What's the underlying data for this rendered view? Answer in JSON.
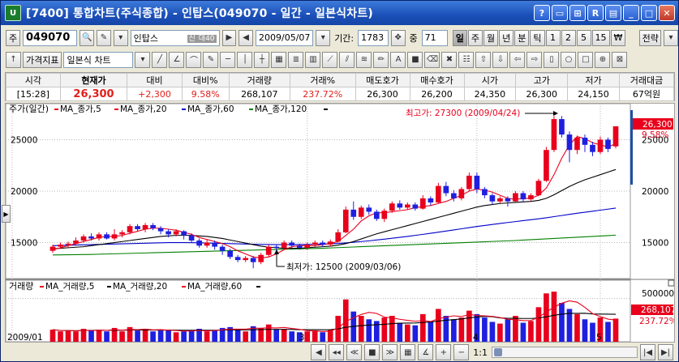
{
  "window": {
    "logo": "U",
    "title": "[7400] 통합차트(주식종합) - 인탑스(049070 - 일간 - 일본식차트)",
    "buttons": [
      "?",
      "▭",
      "⊞",
      "R",
      "▤",
      "_",
      "□",
      "✕"
    ]
  },
  "toolbar1": {
    "market_label": "주",
    "code": "049070",
    "stock_name": "인탑스",
    "badge_credit": "신",
    "badge_margin": "대40",
    "date": "2009/05/07",
    "period_label": "기간:",
    "period_value": "1783",
    "count_label": "중",
    "count_value": "71",
    "intervals": [
      "일",
      "주",
      "월",
      "년",
      "분",
      "틱",
      "1",
      "2",
      "5",
      "15",
      "₩"
    ],
    "selected_interval": "일",
    "strategy_label": "전략"
  },
  "toolbar2": {
    "price_indicator_label": "가격지표",
    "chart_style": "일본식 차트"
  },
  "quote": {
    "headers": [
      "시각",
      "현재가",
      "대비",
      "대비%",
      "거래량",
      "거래%",
      "매도호가",
      "매수호가",
      "시가",
      "고가",
      "저가",
      "거래대금"
    ],
    "values": [
      "[15:28]",
      "26,300",
      "+2,300",
      "9.58%",
      "268,107",
      "237.72%",
      "26,300",
      "26,200",
      "24,350",
      "26,300",
      "24,150",
      "67억원"
    ]
  },
  "price_chart": {
    "legend_title": "주가(일간)",
    "legend": [
      {
        "name": "MA_종가,5",
        "color": "#e8001c"
      },
      {
        "name": "MA_종가,20",
        "color": "#e8001c"
      },
      {
        "name": "MA_종가,60",
        "color": "#0000c8"
      },
      {
        "name": "MA_종가,120",
        "color": "#008000"
      }
    ],
    "high_annotation": "최고가: 27300 (2009/04/24)",
    "low_annotation": "최저가: 12500 (2009/03/06)",
    "current_price_label": "26,300",
    "current_change_label": "9.58%",
    "y_ticks": [
      "25000",
      "20000",
      "15000"
    ]
  },
  "volume_chart": {
    "legend_title": "거래량",
    "legend": [
      {
        "name": "MA_거래량,5",
        "color": "#e8001c"
      },
      {
        "name": "MA_거래량,20",
        "color": "#000000"
      },
      {
        "name": "MA_거래량,60",
        "color": "#e8001c"
      }
    ],
    "y_tick": "500000",
    "current_volume_label": "268,107",
    "current_ratio_label": "237.72%"
  },
  "x_axis": {
    "labels": [
      "2009/01",
      "3",
      "4",
      "5"
    ]
  },
  "chart_data": {
    "type": "candlestick",
    "y_range": [
      11500,
      28500
    ],
    "volume_range": [
      0,
      600000
    ],
    "candles": [
      {
        "o": 14200,
        "c": 14600,
        "h": 14800,
        "l": 14000,
        "v": 140000
      },
      {
        "o": 14600,
        "c": 14800,
        "h": 15000,
        "l": 14400,
        "v": 120000
      },
      {
        "o": 14800,
        "c": 14900,
        "h": 15100,
        "l": 14500,
        "v": 130000
      },
      {
        "o": 14900,
        "c": 15200,
        "h": 15500,
        "l": 14700,
        "v": 120000
      },
      {
        "o": 15200,
        "c": 15600,
        "h": 15800,
        "l": 15000,
        "v": 150000
      },
      {
        "o": 15600,
        "c": 15400,
        "h": 15900,
        "l": 15200,
        "v": 130000
      },
      {
        "o": 15400,
        "c": 15800,
        "h": 16000,
        "l": 15200,
        "v": 140000
      },
      {
        "o": 15800,
        "c": 15400,
        "h": 16000,
        "l": 15300,
        "v": 120000
      },
      {
        "o": 15400,
        "c": 15800,
        "h": 16300,
        "l": 15200,
        "v": 160000
      },
      {
        "o": 15800,
        "c": 16000,
        "h": 16200,
        "l": 15500,
        "v": 120000
      },
      {
        "o": 16000,
        "c": 16600,
        "h": 16800,
        "l": 15800,
        "v": 170000
      },
      {
        "o": 16600,
        "c": 16300,
        "h": 16800,
        "l": 16100,
        "v": 130000
      },
      {
        "o": 16300,
        "c": 16700,
        "h": 16900,
        "l": 16000,
        "v": 150000
      },
      {
        "o": 16700,
        "c": 16400,
        "h": 16900,
        "l": 16200,
        "v": 120000
      },
      {
        "o": 16400,
        "c": 16100,
        "h": 16600,
        "l": 15800,
        "v": 130000
      },
      {
        "o": 16100,
        "c": 15800,
        "h": 16300,
        "l": 15500,
        "v": 140000
      },
      {
        "o": 15800,
        "c": 16100,
        "h": 16300,
        "l": 15600,
        "v": 110000
      },
      {
        "o": 16100,
        "c": 15700,
        "h": 16200,
        "l": 15300,
        "v": 120000
      },
      {
        "o": 15700,
        "c": 15200,
        "h": 15900,
        "l": 15000,
        "v": 130000
      },
      {
        "o": 15200,
        "c": 14700,
        "h": 15400,
        "l": 14500,
        "v": 150000
      },
      {
        "o": 14700,
        "c": 15000,
        "h": 15300,
        "l": 14500,
        "v": 120000
      },
      {
        "o": 15000,
        "c": 14600,
        "h": 15200,
        "l": 14300,
        "v": 130000
      },
      {
        "o": 14600,
        "c": 14200,
        "h": 14800,
        "l": 13800,
        "v": 160000
      },
      {
        "o": 14200,
        "c": 13600,
        "h": 14400,
        "l": 13400,
        "v": 170000
      },
      {
        "o": 13600,
        "c": 13300,
        "h": 13800,
        "l": 13100,
        "v": 150000
      },
      {
        "o": 13300,
        "c": 13500,
        "h": 13700,
        "l": 13100,
        "v": 120000
      },
      {
        "o": 13500,
        "c": 13100,
        "h": 13700,
        "l": 12500,
        "v": 180000
      },
      {
        "o": 13100,
        "c": 13800,
        "h": 14000,
        "l": 12900,
        "v": 160000
      },
      {
        "o": 13800,
        "c": 14600,
        "h": 14800,
        "l": 13600,
        "v": 200000
      },
      {
        "o": 14600,
        "c": 14500,
        "h": 14800,
        "l": 14200,
        "v": 140000
      },
      {
        "o": 14500,
        "c": 15000,
        "h": 15200,
        "l": 14300,
        "v": 150000
      },
      {
        "o": 15000,
        "c": 14700,
        "h": 15200,
        "l": 14500,
        "v": 120000
      },
      {
        "o": 14700,
        "c": 14500,
        "h": 14900,
        "l": 14300,
        "v": 110000
      },
      {
        "o": 14500,
        "c": 14800,
        "h": 15000,
        "l": 14300,
        "v": 120000
      },
      {
        "o": 14800,
        "c": 15000,
        "h": 15200,
        "l": 14600,
        "v": 130000
      },
      {
        "o": 15000,
        "c": 14800,
        "h": 15200,
        "l": 14600,
        "v": 110000
      },
      {
        "o": 14800,
        "c": 15100,
        "h": 15300,
        "l": 14600,
        "v": 140000
      },
      {
        "o": 15100,
        "c": 16000,
        "h": 16300,
        "l": 15000,
        "v": 300000
      },
      {
        "o": 16000,
        "c": 18200,
        "h": 18500,
        "l": 15900,
        "v": 490000
      },
      {
        "o": 18200,
        "c": 17500,
        "h": 19000,
        "l": 17200,
        "v": 350000
      },
      {
        "o": 17500,
        "c": 18400,
        "h": 18600,
        "l": 17300,
        "v": 300000
      },
      {
        "o": 18400,
        "c": 18000,
        "h": 18700,
        "l": 17700,
        "v": 260000
      },
      {
        "o": 18000,
        "c": 17300,
        "h": 18200,
        "l": 17100,
        "v": 240000
      },
      {
        "o": 17300,
        "c": 18100,
        "h": 18300,
        "l": 17000,
        "v": 280000
      },
      {
        "o": 18100,
        "c": 18800,
        "h": 19000,
        "l": 17900,
        "v": 300000
      },
      {
        "o": 18800,
        "c": 18400,
        "h": 19100,
        "l": 18200,
        "v": 220000
      },
      {
        "o": 18400,
        "c": 18700,
        "h": 18900,
        "l": 18200,
        "v": 200000
      },
      {
        "o": 18700,
        "c": 18300,
        "h": 18900,
        "l": 18100,
        "v": 190000
      },
      {
        "o": 18300,
        "c": 19300,
        "h": 19600,
        "l": 18200,
        "v": 320000
      },
      {
        "o": 19300,
        "c": 18900,
        "h": 19500,
        "l": 18600,
        "v": 240000
      },
      {
        "o": 18900,
        "c": 20500,
        "h": 20800,
        "l": 18800,
        "v": 380000
      },
      {
        "o": 20500,
        "c": 19800,
        "h": 20900,
        "l": 19500,
        "v": 300000
      },
      {
        "o": 19800,
        "c": 19300,
        "h": 20100,
        "l": 19000,
        "v": 260000
      },
      {
        "o": 19300,
        "c": 20200,
        "h": 20400,
        "l": 19100,
        "v": 280000
      },
      {
        "o": 20200,
        "c": 21500,
        "h": 21800,
        "l": 20000,
        "v": 360000
      },
      {
        "o": 21500,
        "c": 20200,
        "h": 21800,
        "l": 19800,
        "v": 320000
      },
      {
        "o": 20200,
        "c": 19600,
        "h": 20400,
        "l": 19300,
        "v": 280000
      },
      {
        "o": 19600,
        "c": 19000,
        "h": 19800,
        "l": 18700,
        "v": 230000
      },
      {
        "o": 19000,
        "c": 19300,
        "h": 19500,
        "l": 18800,
        "v": 210000
      },
      {
        "o": 19300,
        "c": 19000,
        "h": 19500,
        "l": 18500,
        "v": 260000
      },
      {
        "o": 19000,
        "c": 19800,
        "h": 20000,
        "l": 18900,
        "v": 300000
      },
      {
        "o": 19800,
        "c": 19200,
        "h": 20000,
        "l": 18900,
        "v": 220000
      },
      {
        "o": 19200,
        "c": 19600,
        "h": 19800,
        "l": 19000,
        "v": 240000
      },
      {
        "o": 19600,
        "c": 21000,
        "h": 21200,
        "l": 19500,
        "v": 400000
      },
      {
        "o": 21000,
        "c": 24000,
        "h": 24300,
        "l": 20900,
        "v": 560000
      },
      {
        "o": 24000,
        "c": 27000,
        "h": 27300,
        "l": 23800,
        "v": 580000
      },
      {
        "o": 27000,
        "c": 25500,
        "h": 27300,
        "l": 25200,
        "v": 450000
      },
      {
        "o": 25500,
        "c": 24000,
        "h": 25800,
        "l": 22800,
        "v": 380000
      },
      {
        "o": 24000,
        "c": 25200,
        "h": 25400,
        "l": 23600,
        "v": 320000
      },
      {
        "o": 25200,
        "c": 24500,
        "h": 25500,
        "l": 23800,
        "v": 260000
      },
      {
        "o": 24500,
        "c": 23800,
        "h": 24800,
        "l": 23400,
        "v": 220000
      },
      {
        "o": 23800,
        "c": 25000,
        "h": 25300,
        "l": 23600,
        "v": 280000
      },
      {
        "o": 25000,
        "c": 24100,
        "h": 25200,
        "l": 23800,
        "v": 230000
      },
      {
        "o": 24350,
        "c": 26300,
        "h": 26300,
        "l": 24150,
        "v": 268107
      }
    ],
    "ma5": [
      14300,
      14500,
      14700,
      14900,
      15100,
      15300,
      15500,
      15600,
      15600,
      15700,
      15900,
      16100,
      16300,
      16400,
      16400,
      16300,
      16200,
      16000,
      15800,
      15500,
      15300,
      15100,
      14900,
      14600,
      14200,
      13900,
      13600,
      13500,
      13600,
      13900,
      14300,
      14600,
      14700,
      14700,
      14700,
      14800,
      14900,
      15100,
      15700,
      16300,
      17100,
      17600,
      17900,
      17900,
      18000,
      18100,
      18200,
      18400,
      18500,
      18600,
      18800,
      19000,
      19300,
      19600,
      20000,
      20200,
      20100,
      19900,
      19600,
      19300,
      19200,
      19300,
      19300,
      19600,
      20300,
      21600,
      23200,
      24500,
      25300,
      25100,
      24700,
      24500,
      24300,
      24600
    ],
    "ma20": [
      14400,
      14450,
      14500,
      14550,
      14600,
      14700,
      14800,
      14900,
      15000,
      15100,
      15200,
      15300,
      15400,
      15500,
      15600,
      15650,
      15700,
      15700,
      15700,
      15650,
      15600,
      15500,
      15400,
      15250,
      15100,
      14950,
      14800,
      14650,
      14550,
      14500,
      14450,
      14450,
      14450,
      14500,
      14550,
      14600,
      14650,
      14750,
      14900,
      15100,
      15350,
      15600,
      15850,
      16050,
      16250,
      16450,
      16650,
      16850,
      17050,
      17250,
      17450,
      17650,
      17850,
      18050,
      18250,
      18450,
      18600,
      18700,
      18800,
      18850,
      18900,
      18950,
      19000,
      19100,
      19300,
      19650,
      20050,
      20450,
      20800,
      21100,
      21350,
      21600,
      21850,
      22100
    ],
    "ma60": [
      14700,
      14720,
      14740,
      14760,
      14780,
      14800,
      14820,
      14840,
      14860,
      14880,
      14900,
      14920,
      14940,
      14960,
      14980,
      15000,
      15000,
      15000,
      14990,
      14980,
      14960,
      14940,
      14920,
      14900,
      14880,
      14860,
      14840,
      14820,
      14810,
      14800,
      14800,
      14800,
      14810,
      14820,
      14840,
      14860,
      14890,
      14920,
      14970,
      15030,
      15100,
      15170,
      15250,
      15330,
      15420,
      15510,
      15600,
      15700,
      15800,
      15900,
      16010,
      16120,
      16230,
      16340,
      16450,
      16560,
      16660,
      16760,
      16860,
      16950,
      17040,
      17130,
      17220,
      17310,
      17410,
      17520,
      17630,
      17740,
      17850,
      17950,
      18050,
      18150,
      18250,
      18350
    ],
    "ma120": [
      13800,
      13810,
      13820,
      13830,
      13840,
      13850,
      13870,
      13890,
      13910,
      13930,
      13950,
      13970,
      13990,
      14010,
      14030,
      14050,
      14070,
      14090,
      14110,
      14130,
      14150,
      14170,
      14190,
      14210,
      14230,
      14250,
      14270,
      14290,
      14310,
      14330,
      14350,
      14370,
      14390,
      14410,
      14430,
      14450,
      14480,
      14510,
      14540,
      14570,
      14600,
      14630,
      14660,
      14690,
      14720,
      14750,
      14780,
      14810,
      14840,
      14870,
      14900,
      14930,
      14960,
      14990,
      15020,
      15050,
      15080,
      15110,
      15140,
      15170,
      15200,
      15240,
      15280,
      15320,
      15360,
      15400,
      15440,
      15480,
      15520,
      15560,
      15600,
      15640,
      15680,
      15720
    ]
  }
}
